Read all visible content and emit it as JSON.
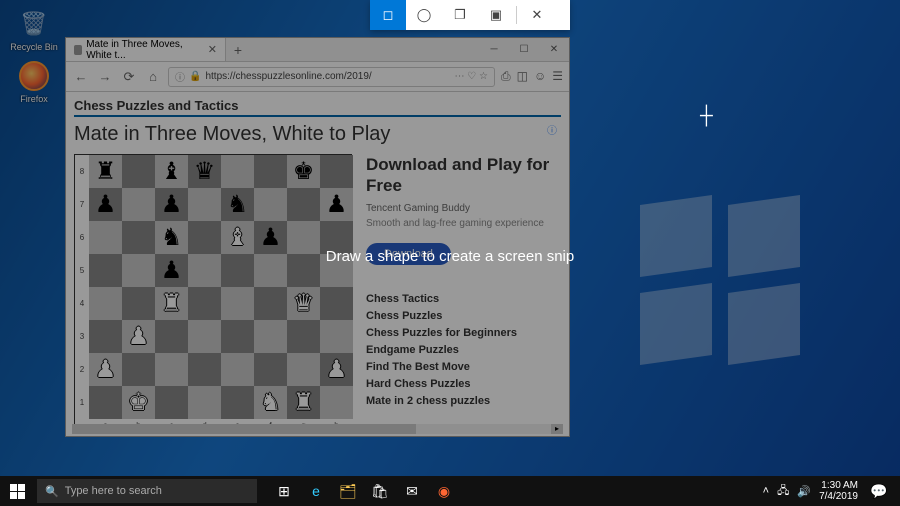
{
  "desktop": {
    "recycle": "Recycle Bin",
    "firefox": "Firefox"
  },
  "browser": {
    "tab_title": "Mate in Three Moves, White t...",
    "url": "https://chesspuzzlesonline.com/2019/",
    "site_title": "Chess Puzzles and Tactics",
    "page_title": "Mate in Three Moves, White to Play"
  },
  "board": {
    "ranks": [
      "8",
      "7",
      "6",
      "5",
      "4",
      "3",
      "2",
      "1"
    ],
    "files": [
      "a",
      "b",
      "c",
      "d",
      "e",
      "f",
      "g",
      "h"
    ],
    "rows": [
      [
        "br",
        "",
        "bb",
        "bq",
        "",
        "",
        "bk",
        ""
      ],
      [
        "bp",
        "",
        "bp",
        "",
        "bn",
        "",
        "",
        "bp"
      ],
      [
        "",
        "",
        "bn",
        "",
        "wb",
        "bp",
        "",
        ""
      ],
      [
        "",
        "",
        "bp",
        "",
        "",
        "",
        "",
        ""
      ],
      [
        "",
        "",
        "wr",
        "",
        "",
        "",
        "wq",
        ""
      ],
      [
        "",
        "wp",
        "",
        "",
        "",
        "",
        "",
        ""
      ],
      [
        "wp",
        "",
        "",
        "",
        "",
        "",
        "",
        "wp"
      ],
      [
        "",
        "wk",
        "",
        "",
        "",
        "wn",
        "wr",
        ""
      ]
    ]
  },
  "ad": {
    "headline": "Download and Play for Free",
    "sub": "Tencent Gaming Buddy",
    "desc": "Smooth and lag-free gaming experience",
    "button": "Download"
  },
  "links": [
    "Chess Tactics",
    "Chess Puzzles",
    "Chess Puzzles for Beginners",
    "Endgame Puzzles",
    "Find The Best Move",
    "Hard Chess Puzzles",
    "Mate in 2 chess puzzles"
  ],
  "snip": {
    "hint": "Draw a shape to create a screen snip"
  },
  "taskbar": {
    "search_placeholder": "Type here to search",
    "time": "1:30 AM",
    "date": "7/4/2019"
  }
}
